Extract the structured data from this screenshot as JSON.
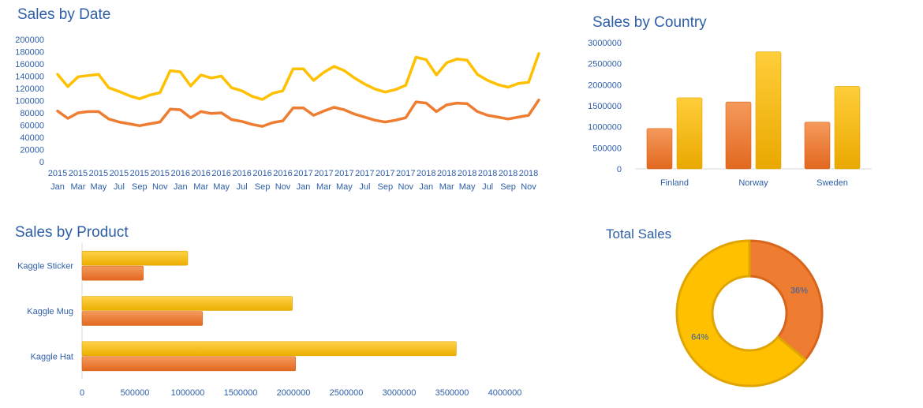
{
  "colors": {
    "orange": "#ee7d31",
    "orange_dark": "#d9641c",
    "yellow": "#ffc000",
    "yellow_dark": "#e0a500",
    "text": "#2e5ea8",
    "axis": "#d9d9d9"
  },
  "chart_data": [
    {
      "id": "sales-by-date",
      "type": "line",
      "title": "Sales by Date",
      "ylim": [
        0,
        200000
      ],
      "yticks": [
        0,
        20000,
        40000,
        60000,
        80000,
        100000,
        120000,
        140000,
        160000,
        180000,
        200000
      ],
      "x": [
        "2015-01",
        "2015-02",
        "2015-03",
        "2015-04",
        "2015-05",
        "2015-06",
        "2015-07",
        "2015-08",
        "2015-09",
        "2015-10",
        "2015-11",
        "2015-12",
        "2016-01",
        "2016-02",
        "2016-03",
        "2016-04",
        "2016-05",
        "2016-06",
        "2016-07",
        "2016-08",
        "2016-09",
        "2016-10",
        "2016-11",
        "2016-12",
        "2017-01",
        "2017-02",
        "2017-03",
        "2017-04",
        "2017-05",
        "2017-06",
        "2017-07",
        "2017-08",
        "2017-09",
        "2017-10",
        "2017-11",
        "2017-12",
        "2018-01",
        "2018-02",
        "2018-03",
        "2018-04",
        "2018-05",
        "2018-06",
        "2018-07",
        "2018-08",
        "2018-09",
        "2018-10",
        "2018-11",
        "2018-12"
      ],
      "xtick_labels": [
        {
          "year": "2015",
          "month": "Jan"
        },
        {
          "year": "2015",
          "month": "Mar"
        },
        {
          "year": "2015",
          "month": "May"
        },
        {
          "year": "2015",
          "month": "Jul"
        },
        {
          "year": "2015",
          "month": "Sep"
        },
        {
          "year": "2015",
          "month": "Nov"
        },
        {
          "year": "2016",
          "month": "Jan"
        },
        {
          "year": "2016",
          "month": "Mar"
        },
        {
          "year": "2016",
          "month": "May"
        },
        {
          "year": "2016",
          "month": "Jul"
        },
        {
          "year": "2016",
          "month": "Sep"
        },
        {
          "year": "2016",
          "month": "Nov"
        },
        {
          "year": "2017",
          "month": "Jan"
        },
        {
          "year": "2017",
          "month": "Mar"
        },
        {
          "year": "2017",
          "month": "May"
        },
        {
          "year": "2017",
          "month": "Jul"
        },
        {
          "year": "2017",
          "month": "Sep"
        },
        {
          "year": "2017",
          "month": "Nov"
        },
        {
          "year": "2018",
          "month": "Jan"
        },
        {
          "year": "2018",
          "month": "Mar"
        },
        {
          "year": "2018",
          "month": "May"
        },
        {
          "year": "2018",
          "month": "Jul"
        },
        {
          "year": "2018",
          "month": "Sep"
        },
        {
          "year": "2018",
          "month": "Nov"
        }
      ],
      "series": [
        {
          "color": "#ffc000",
          "values": [
            143000,
            123000,
            139000,
            141000,
            143000,
            121000,
            115000,
            108000,
            103000,
            109000,
            113000,
            149000,
            147000,
            124000,
            142000,
            137000,
            140000,
            121000,
            116000,
            107000,
            102000,
            112000,
            116000,
            152000,
            152000,
            133000,
            146000,
            156000,
            149000,
            137000,
            127000,
            119000,
            114000,
            118000,
            125000,
            171000,
            167000,
            142000,
            162000,
            168000,
            166000,
            143000,
            133000,
            126000,
            122000,
            128000,
            130000,
            177000
          ]
        },
        {
          "color": "#ee7d31",
          "values": [
            83000,
            71000,
            80000,
            82000,
            82000,
            70000,
            65000,
            62000,
            59000,
            62000,
            65000,
            86000,
            85000,
            72000,
            82000,
            79000,
            80000,
            69000,
            66000,
            61000,
            58000,
            64000,
            67000,
            88000,
            88000,
            76000,
            83000,
            89000,
            85000,
            78000,
            73000,
            68000,
            65000,
            68000,
            72000,
            98000,
            96000,
            82000,
            93000,
            96000,
            95000,
            82000,
            76000,
            73000,
            70000,
            73000,
            76000,
            101000
          ]
        }
      ]
    },
    {
      "id": "sales-by-country",
      "type": "bar",
      "title": "Sales by Country",
      "categories": [
        "Finland",
        "Norway",
        "Sweden"
      ],
      "ylim": [
        0,
        3000000
      ],
      "yticks": [
        0,
        500000,
        1000000,
        1500000,
        2000000,
        2500000,
        3000000
      ],
      "series": [
        {
          "color": "#ee7d31",
          "values": [
            960000,
            1590000,
            1110000
          ]
        },
        {
          "color": "#ffc000",
          "values": [
            1690000,
            2780000,
            1960000
          ]
        }
      ]
    },
    {
      "id": "sales-by-product",
      "type": "bar",
      "orientation": "horizontal",
      "title": "Sales by Product",
      "categories": [
        "Kaggle Sticker",
        "Kaggle Mug",
        "Kaggle Hat"
      ],
      "xlim": [
        0,
        4000000
      ],
      "xticks": [
        0,
        500000,
        1000000,
        1500000,
        2000000,
        2500000,
        3000000,
        3500000,
        4000000
      ],
      "series": [
        {
          "color": "#ffc000",
          "values": [
            1000000,
            1990000,
            3540000
          ]
        },
        {
          "color": "#ee7d31",
          "values": [
            580000,
            1140000,
            2020000
          ]
        }
      ]
    },
    {
      "id": "total-sales",
      "type": "pie",
      "donut": true,
      "title": "Total Sales",
      "slices": [
        {
          "label": "36%",
          "value": 36,
          "color": "#ee7d31"
        },
        {
          "label": "64%",
          "value": 64,
          "color": "#ffc000"
        }
      ]
    }
  ]
}
